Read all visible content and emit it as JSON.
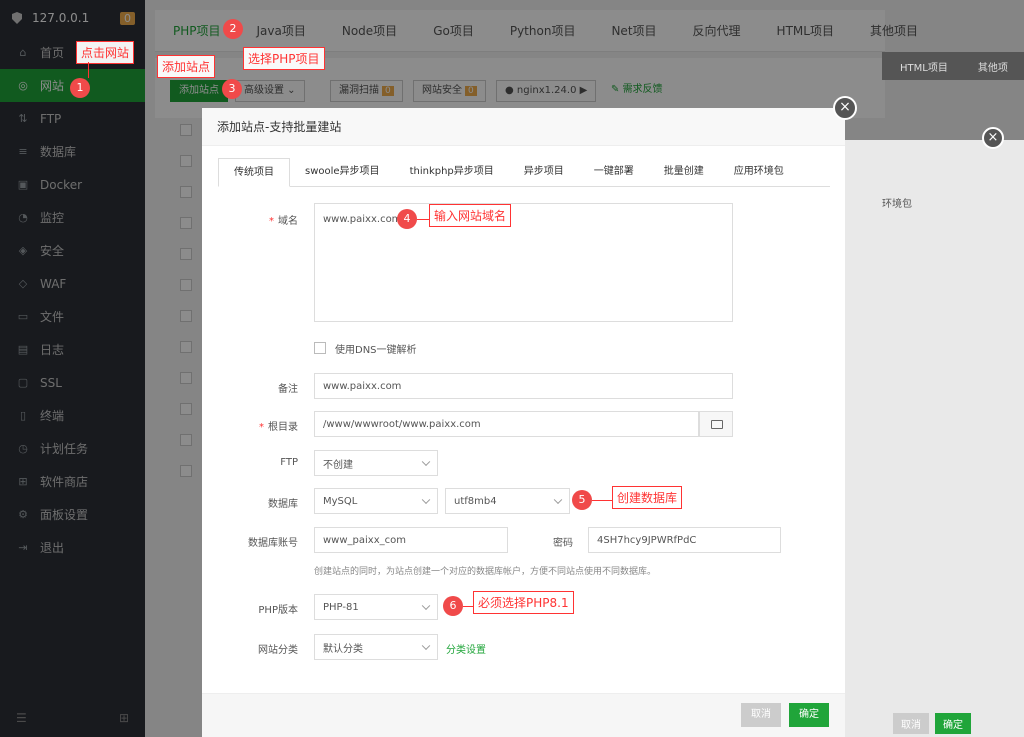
{
  "sidebar": {
    "host": "127.0.0.1",
    "badge": "0",
    "items": [
      {
        "label": "首页",
        "icon": "home-icon",
        "glyph": "⌂"
      },
      {
        "label": "网站",
        "icon": "globe-icon",
        "glyph": "◎"
      },
      {
        "label": "FTP",
        "icon": "ftp-icon",
        "glyph": "⇅"
      },
      {
        "label": "数据库",
        "icon": "database-icon",
        "glyph": "≡"
      },
      {
        "label": "Docker",
        "icon": "docker-icon",
        "glyph": "▣"
      },
      {
        "label": "监控",
        "icon": "monitor-icon",
        "glyph": "◔"
      },
      {
        "label": "安全",
        "icon": "shield-icon",
        "glyph": "◈"
      },
      {
        "label": "WAF",
        "icon": "waf-icon",
        "glyph": "◇"
      },
      {
        "label": "文件",
        "icon": "folder-icon",
        "glyph": "▭"
      },
      {
        "label": "日志",
        "icon": "log-icon",
        "glyph": "▤"
      },
      {
        "label": "SSL",
        "icon": "ssl-icon",
        "glyph": "▢"
      },
      {
        "label": "终端",
        "icon": "terminal-icon",
        "glyph": "▯"
      },
      {
        "label": "计划任务",
        "icon": "clock-icon",
        "glyph": "◷"
      },
      {
        "label": "软件商店",
        "icon": "store-icon",
        "glyph": "⊞"
      },
      {
        "label": "面板设置",
        "icon": "gear-icon",
        "glyph": "⚙"
      },
      {
        "label": "退出",
        "icon": "logout-icon",
        "glyph": "⇥"
      }
    ],
    "active_index": 1
  },
  "top_tabs": [
    "PHP项目",
    "Java项目",
    "Node项目",
    "Go项目",
    "Python项目",
    "Net项目",
    "反向代理",
    "HTML项目",
    "其他项目"
  ],
  "toolbar": {
    "add_site": "添加站点",
    "advanced": "高级设置",
    "scan": "漏洞扫描",
    "scan_count": "0",
    "site_security": "网站安全",
    "security_count": "0",
    "nginx": "nginx1.24.0",
    "feedback": "需求反馈"
  },
  "ghost": {
    "tab1": "HTML项目",
    "tab2": "其他项",
    "title": "环境包",
    "cancel": "取消",
    "ok": "确定"
  },
  "dialog": {
    "title": "添加站点-支持批量建站",
    "tabs": [
      "传统项目",
      "swoole异步项目",
      "thinkphp异步项目",
      "异步项目",
      "一键部署",
      "批量创建",
      "应用环境包"
    ],
    "domain_label": "域名",
    "domain_value": "www.paixx.com",
    "dns_label": "使用DNS一键解析",
    "remark_label": "备注",
    "remark_value": "www.paixx.com",
    "root_label": "根目录",
    "root_value": "/www/wwwroot/www.paixx.com",
    "ftp_label": "FTP",
    "ftp_value": "不创建",
    "db_label": "数据库",
    "db_type": "MySQL",
    "db_charset": "utf8mb4",
    "db_user_label": "数据库账号",
    "db_user_value": "www_paixx_com",
    "pwd_label": "密码",
    "pwd_value": "4SH7hcy9JPWRfPdC",
    "db_hint": "创建站点的同时，为站点创建一个对应的数据库帐户，方便不同站点使用不同数据库。",
    "php_label": "PHP版本",
    "php_value": "PHP-81",
    "category_label": "网站分类",
    "category_value": "默认分类",
    "category_link": "分类设置",
    "cancel": "取消",
    "ok": "确定"
  },
  "annotations": {
    "n1": "1",
    "n2": "2",
    "n3": "3",
    "n4": "4",
    "n5": "5",
    "n6": "6",
    "click_site": "点击网站",
    "add_site": "添加站点",
    "select_php": "选择PHP项目",
    "enter_domain": "输入网站域名",
    "create_db": "创建数据库",
    "must_php": "必须选择PHP8.1"
  },
  "colors": {
    "accent": "#20a53a",
    "annotation": "#f33333",
    "sidebar": "#2c3138"
  }
}
